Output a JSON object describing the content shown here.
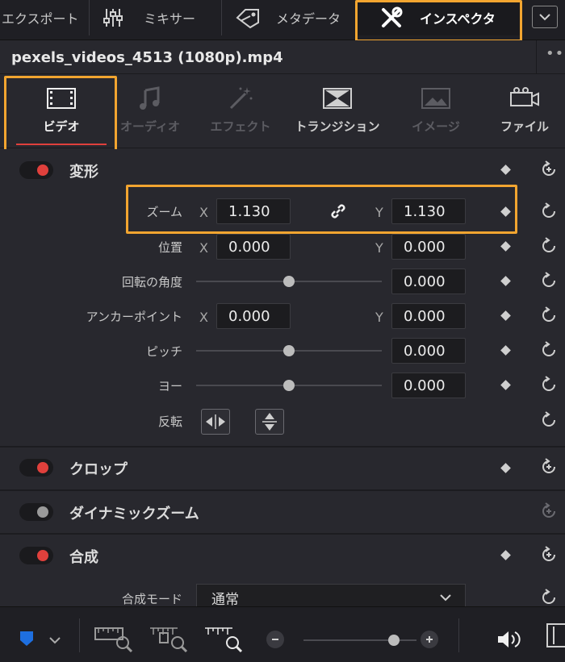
{
  "tabs": {
    "export": "エクスポート",
    "mixer": "ミキサー",
    "metadata": "メタデータ",
    "inspector": "インスペクタ"
  },
  "file": {
    "name": "pexels_videos_4513 (1080p).mp4",
    "more": "••"
  },
  "subtabs": {
    "video": "ビデオ",
    "audio": "オーディオ",
    "effects": "エフェクト",
    "transition": "トランジション",
    "image": "イメージ",
    "file": "ファイル"
  },
  "transform": {
    "title": "変形",
    "zoom": {
      "label": "ズーム",
      "x_axis": "X",
      "y_axis": "Y",
      "x": "1.130",
      "y": "1.130"
    },
    "position": {
      "label": "位置",
      "x_axis": "X",
      "y_axis": "Y",
      "x": "0.000",
      "y": "0.000"
    },
    "rotation": {
      "label": "回転の角度",
      "value": "0.000",
      "slider": 0.5
    },
    "anchor": {
      "label": "アンカーポイント",
      "x_axis": "X",
      "y_axis": "Y",
      "x": "0.000",
      "y": "0.000"
    },
    "pitch": {
      "label": "ピッチ",
      "value": "0.000",
      "slider": 0.5
    },
    "yaw": {
      "label": "ヨー",
      "value": "0.000",
      "slider": 0.5
    },
    "flip": {
      "label": "反転"
    }
  },
  "crop": {
    "title": "クロップ",
    "enabled": true
  },
  "dynamic_zoom": {
    "title": "ダイナミックズーム",
    "enabled": false
  },
  "composite": {
    "title": "合成",
    "enabled": true,
    "mode_label": "合成モード",
    "mode_value": "通常"
  },
  "bottom": {
    "zoom_level": 0.8
  },
  "colors": {
    "accent": "#e0403c",
    "highlight": "#f2a530",
    "flag": "#1e6fe0"
  }
}
